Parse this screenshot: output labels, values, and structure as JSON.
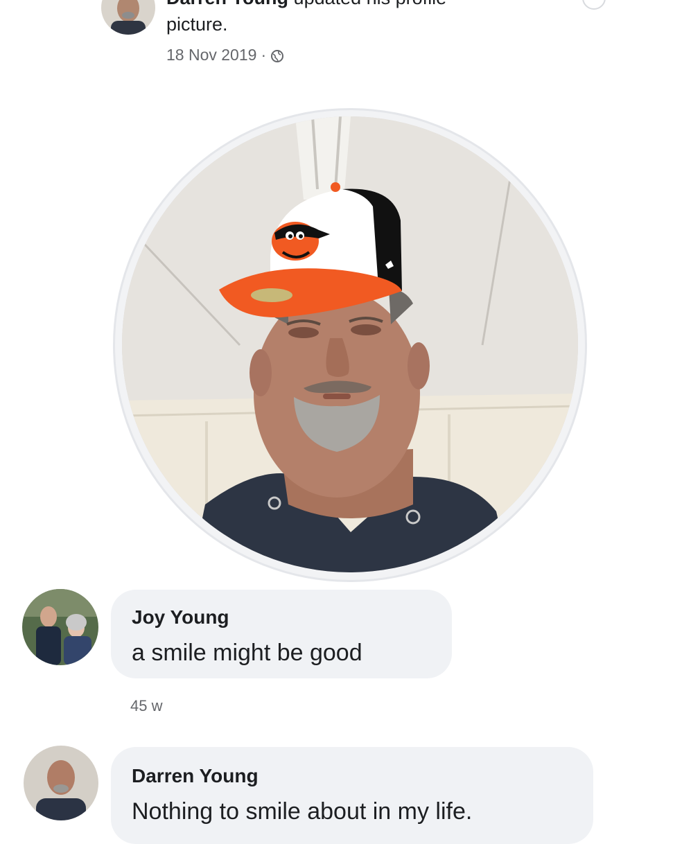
{
  "post": {
    "author": "Darren Young",
    "action_text": "updated his profile",
    "action_line2": "picture.",
    "date": "18 Nov 2019",
    "separator": "·",
    "privacy_icon": "globe-icon"
  },
  "profile_picture": {
    "description_icon": "profile-photo",
    "hat_logo": "orioles-cap"
  },
  "comments": [
    {
      "author": "Joy Young",
      "text": "a smile might be good",
      "time": "45 w"
    },
    {
      "author": "Darren Young",
      "text": "Nothing to smile about in my life."
    }
  ],
  "colors": {
    "bubble": "#f0f2f5",
    "meta_text": "#65676b",
    "orange": "#f15a22",
    "black": "#111111"
  }
}
